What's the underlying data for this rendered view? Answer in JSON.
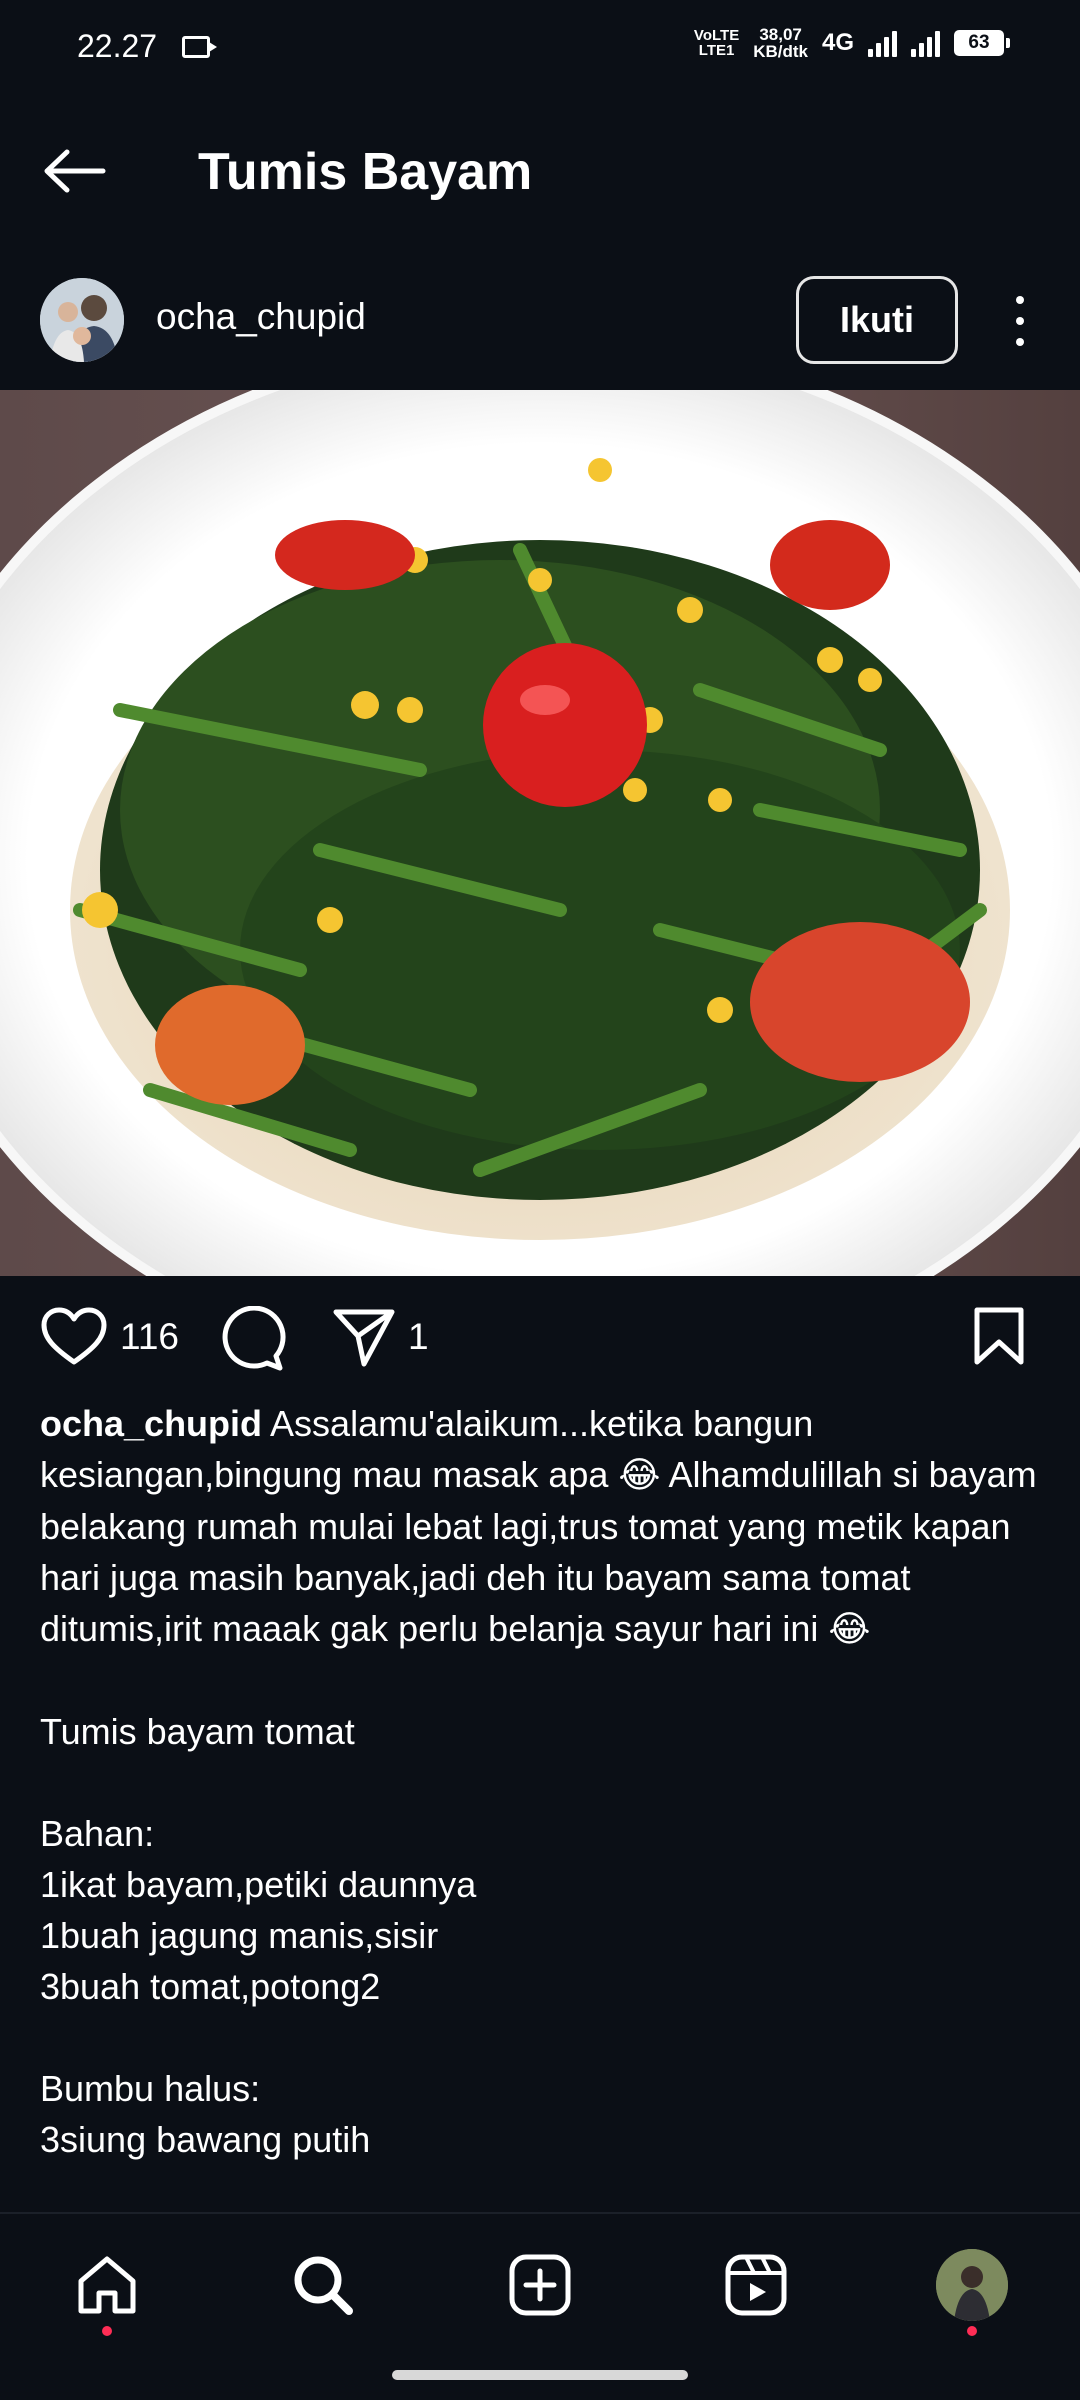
{
  "status_bar": {
    "time": "22.27",
    "volte_line1": "VoLTE",
    "volte_line2": "LTE1",
    "speed_value": "38,07",
    "speed_unit": "KB/dtk",
    "network": "4G",
    "battery": "63"
  },
  "header": {
    "title": "Tumis Bayam",
    "back_icon": "arrow-left-icon"
  },
  "post": {
    "username": "ocha_chupid",
    "follow_label": "Ikuti",
    "image_description_icon": "food-photo",
    "likes": "116",
    "shares": "1",
    "caption_first": "Assalamu'alaikum...ketika bangun kesiangan,bingung mau masak apa",
    "caption_second": " Alhamdulillah si bayam belakang rumah mulai lebat lagi,trus tomat yang metik kapan hari juga masih banyak,jadi deh itu bayam sama tomat ditumis,irit maaak gak perlu belanja sayur hari ini",
    "emoji": "😂",
    "lines": [
      "Tumis bayam tomat",
      "",
      "Bahan:",
      "1ikat bayam,petiki daunnya",
      "1buah jagung manis,sisir",
      "3buah tomat,potong2",
      "",
      "Bumbu halus:",
      "3siung bawang putih"
    ]
  },
  "bottom_nav": {
    "items": [
      "home-icon",
      "search-icon",
      "add-post-icon",
      "reels-icon",
      "profile-avatar"
    ]
  },
  "colors": {
    "background": "#0b0f16",
    "notification_dot": "#ff2d55"
  }
}
